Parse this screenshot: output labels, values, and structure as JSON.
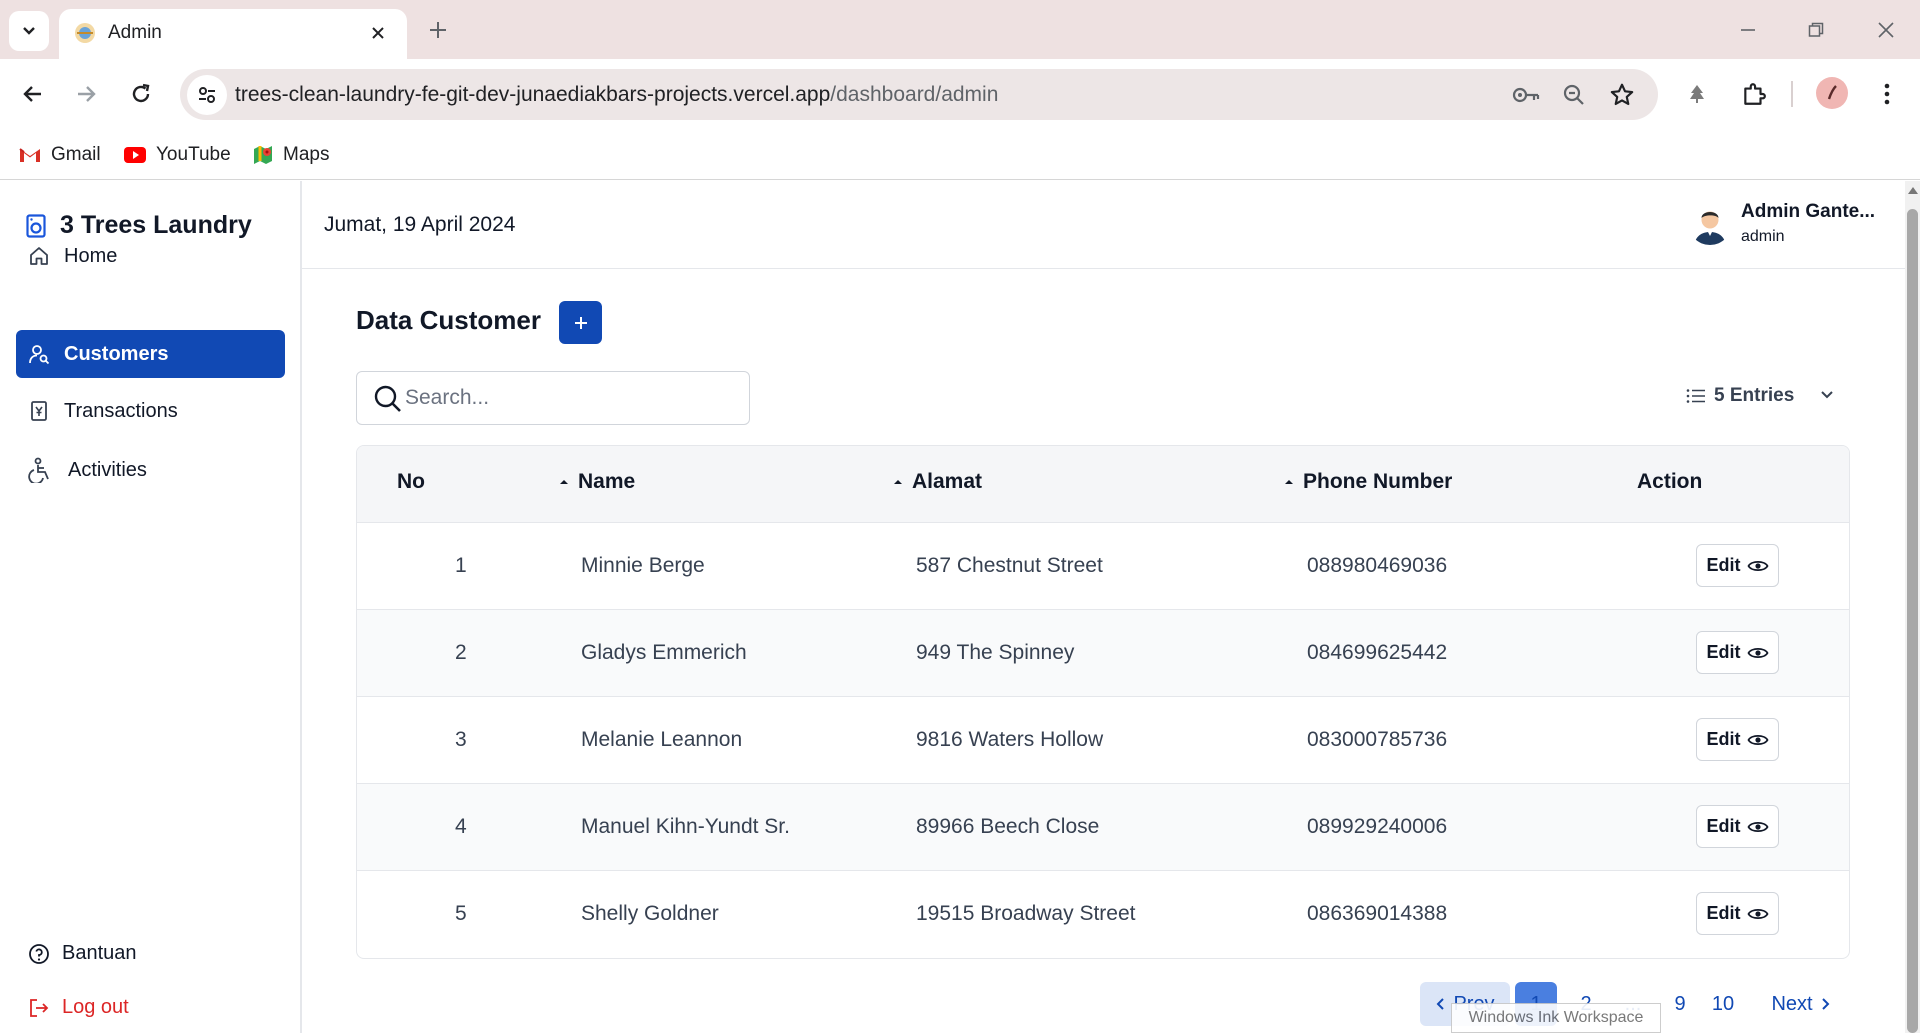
{
  "browser": {
    "tab_title": "Admin",
    "url_host": "trees-clean-laundry-fe-git-dev-junaediakbars-projects.vercel.app",
    "url_path": "/dashboard/admin",
    "bookmarks": [
      {
        "label": "Gmail",
        "icon": "gmail-icon"
      },
      {
        "label": "YouTube",
        "icon": "youtube-icon"
      },
      {
        "label": "Maps",
        "icon": "maps-icon"
      }
    ]
  },
  "sidebar": {
    "brand": "3 Trees Laundry",
    "items": [
      {
        "label": "Home",
        "icon": "home-icon",
        "active": false
      },
      {
        "label": "Customers",
        "icon": "customers-icon",
        "active": true
      },
      {
        "label": "Transactions",
        "icon": "transactions-icon",
        "active": false
      },
      {
        "label": "Activities",
        "icon": "activities-icon",
        "active": false
      }
    ],
    "help": "Bantuan",
    "logout": "Log out"
  },
  "header": {
    "date": "Jumat, 19 April 2024",
    "user_name": "Admin Gante...",
    "user_role": "admin"
  },
  "page": {
    "title": "Data Customer",
    "add_label": "+",
    "search_placeholder": "Search...",
    "entries_label": "5 Entries"
  },
  "table": {
    "columns": [
      "No",
      "Name",
      "Alamat",
      "Phone Number",
      "Action"
    ],
    "rows": [
      {
        "no": "1",
        "name": "Minnie Berge",
        "alamat": "587 Chestnut Street",
        "phone": "088980469036",
        "action": "Edit"
      },
      {
        "no": "2",
        "name": "Gladys Emmerich",
        "alamat": "949 The Spinney",
        "phone": "084699625442",
        "action": "Edit"
      },
      {
        "no": "3",
        "name": "Melanie Leannon",
        "alamat": "9816 Waters Hollow",
        "phone": "083000785736",
        "action": "Edit"
      },
      {
        "no": "4",
        "name": "Manuel Kihn-Yundt Sr.",
        "alamat": "89966 Beech Close",
        "phone": "089929240006",
        "action": "Edit"
      },
      {
        "no": "5",
        "name": "Shelly Goldner",
        "alamat": "19515 Broadway Street",
        "phone": "086369014388",
        "action": "Edit"
      }
    ]
  },
  "pagination": {
    "prev": "Prev",
    "current": "1",
    "pages": [
      "2",
      "...",
      "9",
      "10"
    ],
    "next": "Next"
  },
  "overlay": {
    "ink_tip": "Windows Ink Workspace"
  },
  "colors": {
    "accent": "#1149b4",
    "tabbar": "#eee1e1"
  }
}
